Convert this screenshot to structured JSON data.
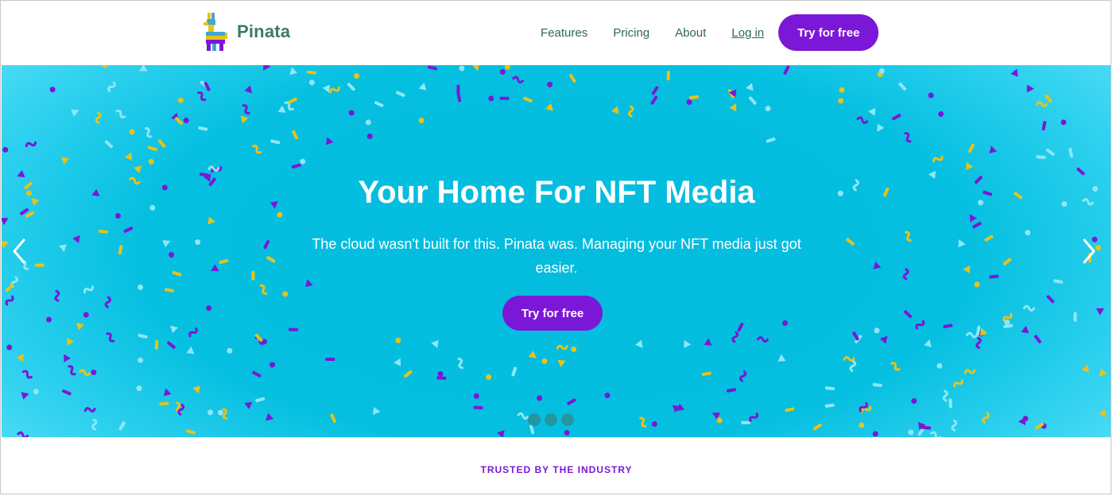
{
  "brand": {
    "name": "Pinata"
  },
  "nav": {
    "links": [
      "Features",
      "Pricing",
      "About"
    ],
    "login": "Log in",
    "cta": "Try for free"
  },
  "hero": {
    "title": "Your Home For NFT Media",
    "subtitle": "The cloud wasn't built for this. Pinata was. Managing your NFT media just got easier.",
    "cta": "Try for free",
    "slides_count": 3
  },
  "trusted": {
    "label": "TRUSTED BY THE INDUSTRY"
  },
  "colors": {
    "accent": "#7b17d6",
    "brand_text": "#3e7a6b",
    "hero_bg": "#05bfe0",
    "confetti_purple": "#7b17d6",
    "confetti_yellow": "#e8c21a",
    "confetti_light": "#8fe6f7"
  },
  "icons": [
    "pinata-logo-icon",
    "chevron-left-icon",
    "chevron-right-icon"
  ]
}
